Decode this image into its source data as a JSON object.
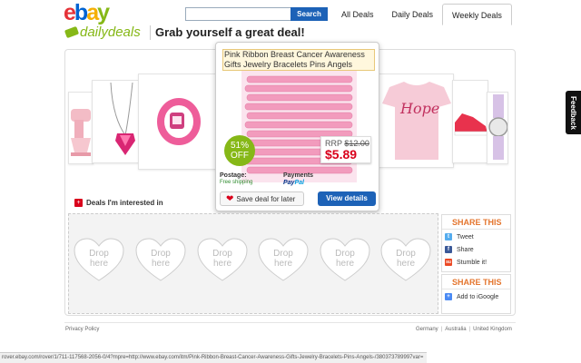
{
  "header": {
    "logo_letters": [
      "e",
      "b",
      "a",
      "y"
    ],
    "search_button": "Search",
    "search_placeholder": "",
    "tabs": [
      {
        "label": "All Deals"
      },
      {
        "label": "Daily Deals"
      },
      {
        "label": "Weekly Deals",
        "active": true
      }
    ]
  },
  "brand": {
    "daily_deals": "dailydeals",
    "tagline": "Grab yourself a great deal!"
  },
  "popup": {
    "title": "Pink Ribbon Breast Cancer Awareness Gifts Jewelry Bracelets Pins Angels",
    "discount_pct": "51%",
    "discount_label": "OFF",
    "rrp_label": "RRP",
    "rrp_price": "$12.00",
    "price": "$5.89",
    "postage_label": "Postage:",
    "postage_value": "Free shipping",
    "payments_label": "Payments",
    "paypal_pay": "Pay",
    "paypal_pal": "Pal",
    "save_button": "Save deal for later",
    "view_button": "View details"
  },
  "carousel": {
    "hope_text": "Hope"
  },
  "deals": {
    "heading": "Deals I'm interested in",
    "drop_slots": [
      {
        "line1": "Drop",
        "line2": "here"
      },
      {
        "line1": "Drop",
        "line2": "here"
      },
      {
        "line1": "Drop",
        "line2": "here"
      },
      {
        "line1": "Drop",
        "line2": "here"
      },
      {
        "line1": "Drop",
        "line2": "here"
      },
      {
        "line1": "Drop",
        "line2": "here"
      }
    ]
  },
  "share": {
    "title": "SHARE THIS",
    "items": [
      {
        "label": "Tweet",
        "icon": "twitter-icon",
        "color": "#55acee",
        "glyph": "t"
      },
      {
        "label": "Share",
        "icon": "facebook-icon",
        "color": "#3b5998",
        "glyph": "f"
      },
      {
        "label": "Stumble it!",
        "icon": "stumbleupon-icon",
        "color": "#eb4924",
        "glyph": "su"
      }
    ],
    "title2": "SHARE THIS",
    "items2": [
      {
        "label": "Add to iGoogle",
        "icon": "igoogle-icon",
        "color": "#4a8af4",
        "glyph": "+"
      }
    ]
  },
  "footer": {
    "privacy": "Privacy Policy",
    "links": [
      "Germany",
      "Australia",
      "United Kingdom"
    ]
  },
  "status_bar": "rover.ebay.com/rover/1/711-117568-2056-0/4?mpre=http://www.ebay.com/itm/Pink-Ribbon-Breast-Cancer-Awareness-Gifts-Jewelry-Bracelets-Pins-Angels-/380373789997var=",
  "feedback": "Feedback",
  "colors": {
    "accent_blue": "#1d62b7",
    "accent_green": "#86b817",
    "price_red": "#d9001b",
    "share_orange": "#e4762f"
  }
}
